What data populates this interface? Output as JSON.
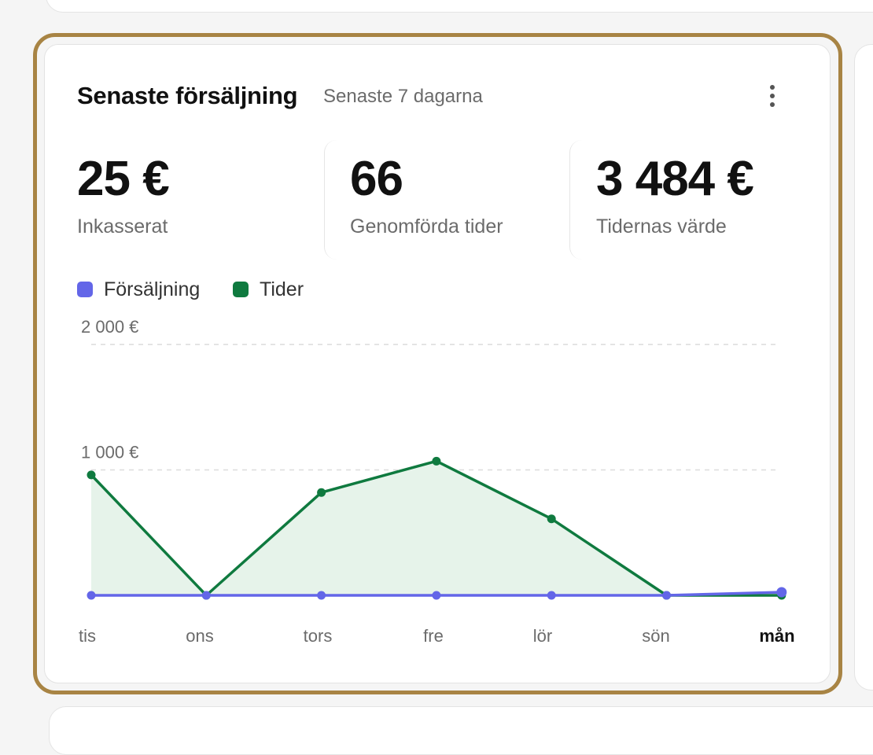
{
  "card": {
    "title": "Senaste försäljning",
    "subtitle": "Senaste 7 dagarna",
    "menu_icon": "more-vertical-icon"
  },
  "stats": [
    {
      "value": "25 €",
      "label": "Inkasserat"
    },
    {
      "value": "66",
      "label": "Genomförda tider"
    },
    {
      "value": "3 484 €",
      "label": "Tidernas värde"
    }
  ],
  "colors": {
    "sales": "#6366e8",
    "appointments": "#0f7a3f",
    "appointments_fill": "#e6f3ea",
    "highlight_border": "#a88444"
  },
  "chart_data": {
    "type": "line",
    "categories": [
      "tis",
      "ons",
      "tors",
      "fre",
      "lör",
      "sön",
      "mån"
    ],
    "highlighted_category": "mån",
    "y_ticks": [
      "1 000 €",
      "2 000 €"
    ],
    "ylim": [
      0,
      2000
    ],
    "grid": true,
    "legend": "top-left",
    "series": [
      {
        "name": "Försäljning",
        "values": [
          0,
          0,
          0,
          0,
          0,
          0,
          25
        ]
      },
      {
        "name": "Tider",
        "values": [
          960,
          0,
          820,
          1070,
          610,
          0,
          0
        ]
      }
    ]
  }
}
